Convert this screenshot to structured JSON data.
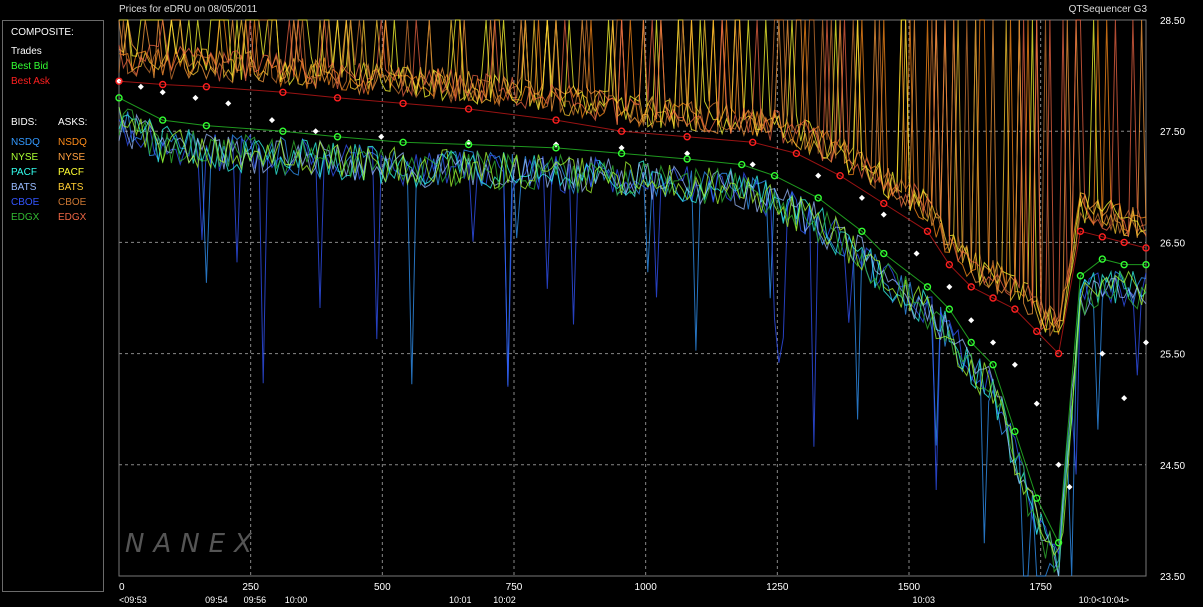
{
  "header": {
    "title": "Prices for  eDRU  on  08/05/2011",
    "app": "QTSequencer G3"
  },
  "legend": {
    "composite_label": "COMPOSITE:",
    "composite": [
      {
        "label": "Trades",
        "color": "#ffffff"
      },
      {
        "label": "Best Bid",
        "color": "#33ff33"
      },
      {
        "label": "Best Ask",
        "color": "#ff2020"
      }
    ],
    "bids_label": "BIDS:",
    "asks_label": "ASKS:",
    "exchanges": [
      {
        "bid": "NSDQ",
        "bid_color": "#3399ff",
        "ask": "NSDQ",
        "ask_color": "#ff8c1a"
      },
      {
        "bid": "NYSE",
        "bid_color": "#aaff33",
        "ask": "NYSE",
        "ask_color": "#ffa040"
      },
      {
        "bid": "PACF",
        "bid_color": "#33ffee",
        "ask": "PACF",
        "ask_color": "#ffff33"
      },
      {
        "bid": "BATS",
        "bid_color": "#99bbff",
        "ask": "BATS",
        "ask_color": "#ffcc33"
      },
      {
        "bid": "CBOE",
        "bid_color": "#3355ff",
        "ask": "CBOE",
        "ask_color": "#cc7733"
      },
      {
        "bid": "EDGX",
        "bid_color": "#33bb33",
        "ask": "EDGX",
        "ask_color": "#ee6644"
      }
    ]
  },
  "watermark": "NANEX",
  "chart_data": {
    "type": "line",
    "title": "Prices for  eDRU  on  08/05/2011",
    "xlabel": "",
    "ylabel": "",
    "xlim": [
      0,
      940
    ],
    "ylim": [
      23.5,
      28.5
    ],
    "x_ticks": [
      "0",
      "250",
      "500",
      "750",
      "1000",
      "1250",
      "1500",
      "1750"
    ],
    "y_ticks": [
      "28.50",
      "27.50",
      "26.50",
      "25.50",
      "24.50",
      "23.50"
    ],
    "time_labels": [
      {
        "seq": 0,
        "label": "<09:53"
      },
      {
        "seq": 185,
        "label": "09:54"
      },
      {
        "seq": 258,
        "label": "09:56"
      },
      {
        "seq": 336,
        "label": "10:00"
      },
      {
        "seq": 648,
        "label": "10:01"
      },
      {
        "seq": 732,
        "label": "10:02"
      },
      {
        "seq": 1528,
        "label": "10:03"
      },
      {
        "seq": 1870,
        "label": "10:0<10:04>"
      }
    ],
    "grid": true,
    "series": [
      {
        "name": "Trades",
        "color": "#ffffff",
        "style": "diamonds",
        "points": [
          [
            0,
            27.95
          ],
          [
            20,
            27.9
          ],
          [
            40,
            27.85
          ],
          [
            70,
            27.8
          ],
          [
            100,
            27.75
          ],
          [
            140,
            27.6
          ],
          [
            180,
            27.5
          ],
          [
            240,
            27.45
          ],
          [
            320,
            27.4
          ],
          [
            400,
            27.38
          ],
          [
            460,
            27.35
          ],
          [
            520,
            27.3
          ],
          [
            580,
            27.2
          ],
          [
            640,
            27.1
          ],
          [
            680,
            26.9
          ],
          [
            700,
            26.75
          ],
          [
            730,
            26.4
          ],
          [
            760,
            26.1
          ],
          [
            780,
            25.8
          ],
          [
            800,
            25.6
          ],
          [
            820,
            25.4
          ],
          [
            840,
            25.05
          ],
          [
            860,
            24.5
          ],
          [
            870,
            24.3
          ],
          [
            900,
            25.5
          ],
          [
            920,
            25.1
          ],
          [
            940,
            25.6
          ]
        ]
      },
      {
        "name": "Best Bid",
        "color": "#33ff33",
        "style": "circles",
        "points": [
          [
            0,
            27.8
          ],
          [
            40,
            27.6
          ],
          [
            80,
            27.55
          ],
          [
            150,
            27.5
          ],
          [
            200,
            27.45
          ],
          [
            260,
            27.4
          ],
          [
            320,
            27.38
          ],
          [
            400,
            27.35
          ],
          [
            460,
            27.3
          ],
          [
            520,
            27.25
          ],
          [
            570,
            27.2
          ],
          [
            600,
            27.1
          ],
          [
            640,
            26.9
          ],
          [
            680,
            26.6
          ],
          [
            700,
            26.4
          ],
          [
            740,
            26.1
          ],
          [
            760,
            25.9
          ],
          [
            780,
            25.6
          ],
          [
            800,
            25.4
          ],
          [
            820,
            24.8
          ],
          [
            840,
            24.2
          ],
          [
            860,
            23.8
          ],
          [
            880,
            26.2
          ],
          [
            900,
            26.35
          ],
          [
            920,
            26.3
          ],
          [
            940,
            26.3
          ]
        ]
      },
      {
        "name": "Best Ask",
        "color": "#ff2020",
        "style": "circles",
        "points": [
          [
            0,
            27.95
          ],
          [
            40,
            27.92
          ],
          [
            80,
            27.9
          ],
          [
            150,
            27.85
          ],
          [
            200,
            27.8
          ],
          [
            260,
            27.75
          ],
          [
            320,
            27.7
          ],
          [
            400,
            27.6
          ],
          [
            460,
            27.5
          ],
          [
            520,
            27.45
          ],
          [
            580,
            27.4
          ],
          [
            620,
            27.3
          ],
          [
            660,
            27.1
          ],
          [
            700,
            26.85
          ],
          [
            740,
            26.6
          ],
          [
            760,
            26.3
          ],
          [
            780,
            26.1
          ],
          [
            800,
            26.0
          ],
          [
            820,
            25.9
          ],
          [
            840,
            25.7
          ],
          [
            860,
            25.5
          ],
          [
            880,
            26.6
          ],
          [
            900,
            26.55
          ],
          [
            920,
            26.5
          ],
          [
            940,
            26.45
          ]
        ]
      }
    ]
  }
}
